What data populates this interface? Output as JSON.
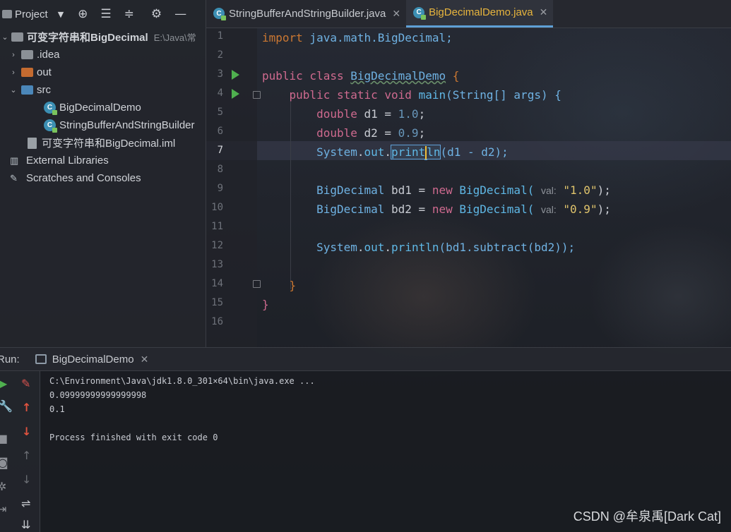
{
  "project": {
    "title": "Project",
    "tree": [
      {
        "label": "可变字符串和BigDecimal",
        "path": "E:\\Java\\常",
        "type": "root"
      },
      {
        "label": ".idea",
        "type": "folder"
      },
      {
        "label": "out",
        "type": "folder"
      },
      {
        "label": "src",
        "type": "folder"
      },
      {
        "label": "BigDecimalDemo",
        "type": "class"
      },
      {
        "label": "StringBufferAndStringBuilder",
        "type": "class"
      },
      {
        "label": "可变字符串和BigDecimal.iml",
        "type": "file"
      },
      {
        "label": "External Libraries",
        "type": "library"
      },
      {
        "label": "Scratches and Consoles",
        "type": "scratch"
      }
    ]
  },
  "editor": {
    "tabs": [
      {
        "label": "StringBufferAndStringBuilder.java",
        "active": false
      },
      {
        "label": "BigDecimalDemo.java",
        "active": true
      }
    ],
    "line_numbers": [
      "1",
      "2",
      "3",
      "4",
      "5",
      "6",
      "7",
      "8",
      "9",
      "10",
      "11",
      "12",
      "13",
      "14",
      "15",
      "16"
    ],
    "current_line": 7,
    "code": {
      "l1_kw": "import",
      "l1_rest": " java.math.BigDecimal;",
      "l3_kw": "public class",
      "l3_cls": "BigDecimalDemo",
      "l3_brace": " {",
      "l4_kw": "public static void",
      "l4_fn": "main",
      "l4_rest": "(String[] args) {",
      "l5_kw": "double",
      "l5_var": " d1 = ",
      "l5_num": "1.0",
      "l5_end": ";",
      "l6_kw": "double",
      "l6_var": " d2 = ",
      "l6_num": "0.9",
      "l6_end": ";",
      "l7_sys": "System",
      "l7_dot1": ".",
      "l7_out": "out",
      "l7_dot2": ".",
      "l7_fn_a": "print",
      "l7_fn_b": "ln",
      "l7_rest": "(d1 - d2);",
      "l9_type": "BigDecimal",
      "l9_var": " bd1 = ",
      "l9_new": "new",
      "l9_ctor": " BigDecimal(",
      "l9_hint": "val:",
      "l9_str": "\"1.0\"",
      "l9_end": ");",
      "l10_type": "BigDecimal",
      "l10_var": " bd2 = ",
      "l10_new": "new",
      "l10_ctor": " BigDecimal(",
      "l10_hint": "val:",
      "l10_str": "\"0.9\"",
      "l10_end": ");",
      "l12_sys": "System",
      "l12_dot1": ".",
      "l12_out": "out",
      "l12_dot2": ".",
      "l12_fn": "println",
      "l12_rest": "(bd1.subtract(bd2));",
      "l14": "}",
      "l15": "}"
    }
  },
  "run": {
    "label": "Run:",
    "tab_label": "BigDecimalDemo",
    "output": [
      "C:\\Environment\\Java\\jdk1.8.0_301×64\\bin\\java.exe ...",
      "0.09999999999999998",
      "0.1",
      "",
      "Process finished with exit code 0"
    ]
  },
  "watermark": "CSDN @牟泉禹[Dark Cat]"
}
